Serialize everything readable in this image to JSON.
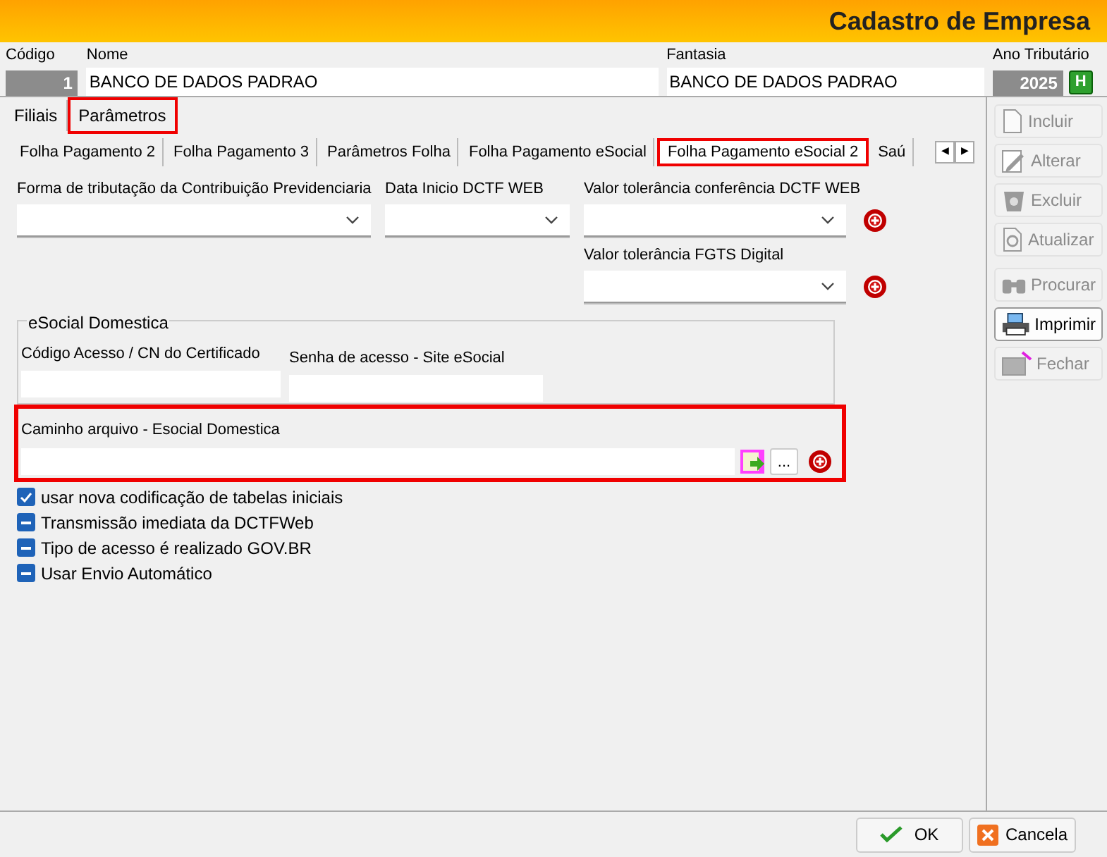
{
  "window": {
    "title": "Cadastro de Empresa"
  },
  "header_fields": {
    "codigo": {
      "label": "Código",
      "value": "1"
    },
    "nome": {
      "label": "Nome",
      "value": "BANCO DE DADOS PADRAO"
    },
    "fantasia": {
      "label": "Fantasia",
      "value": "BANCO DE DADOS PADRAO"
    },
    "ano": {
      "label": "Ano Tributário",
      "value": "2025",
      "button": "H"
    }
  },
  "tabs": [
    {
      "label": "Filiais",
      "selected": false,
      "highlighted": false
    },
    {
      "label": "Parâmetros",
      "selected": true,
      "highlighted": true
    }
  ],
  "subtabs": [
    {
      "label": "Folha Pagamento 2",
      "selected": false,
      "highlighted": false
    },
    {
      "label": "Folha Pagamento 3",
      "selected": false,
      "highlighted": false
    },
    {
      "label": "Parâmetros Folha",
      "selected": false,
      "highlighted": false
    },
    {
      "label": "Folha Pagamento eSocial",
      "selected": false,
      "highlighted": false
    },
    {
      "label": "Folha Pagamento eSocial 2",
      "selected": true,
      "highlighted": true
    },
    {
      "label": "Saú",
      "selected": false,
      "highlighted": false
    }
  ],
  "subtab_scroll": [
    "◀",
    "▶"
  ],
  "form": {
    "forma": {
      "label": "Forma de tributação da Contribuição Previdenciaria"
    },
    "data_inicio": {
      "label": "Data Inicio DCTF WEB"
    },
    "tolerancia_dctf": {
      "label": "Valor tolerância conferência DCTF WEB"
    },
    "tolerancia_fgts": {
      "label": "Valor tolerância FGTS Digital"
    }
  },
  "esocial_domestica": {
    "title": "eSocial Domestica",
    "codigo_acesso": {
      "label": "Código Acesso / CN do Certificado"
    },
    "senha": {
      "label": "Senha de acesso - Site eSocial"
    }
  },
  "caminho": {
    "label": "Caminho arquivo - Esocial Domestica",
    "highlighted": true,
    "browse_button": "..."
  },
  "checkboxes": [
    {
      "label": "usar nova codificação de tabelas iniciais",
      "checked": true
    },
    {
      "label": "Transmissão imediata da DCTFWeb",
      "checked": false
    },
    {
      "label": "Tipo de acesso é realizado GOV.BR",
      "checked": false
    },
    {
      "label": "Usar Envio Automático",
      "checked": false
    }
  ],
  "toolbar": [
    {
      "label": "Incluir",
      "kind": "new",
      "disabled": true
    },
    {
      "label": "Alterar",
      "kind": "edit",
      "disabled": true
    },
    {
      "label": "Excluir",
      "kind": "delete",
      "disabled": true
    },
    {
      "label": "Atualizar",
      "kind": "refresh",
      "disabled": true
    },
    {
      "label": "Procurar",
      "kind": "find",
      "disabled": true
    },
    {
      "label": "Imprimir",
      "kind": "print",
      "disabled": false
    },
    {
      "label": "Fechar",
      "kind": "close",
      "disabled": true
    }
  ],
  "footer": {
    "ok": "OK",
    "cancel": "Cancela"
  }
}
